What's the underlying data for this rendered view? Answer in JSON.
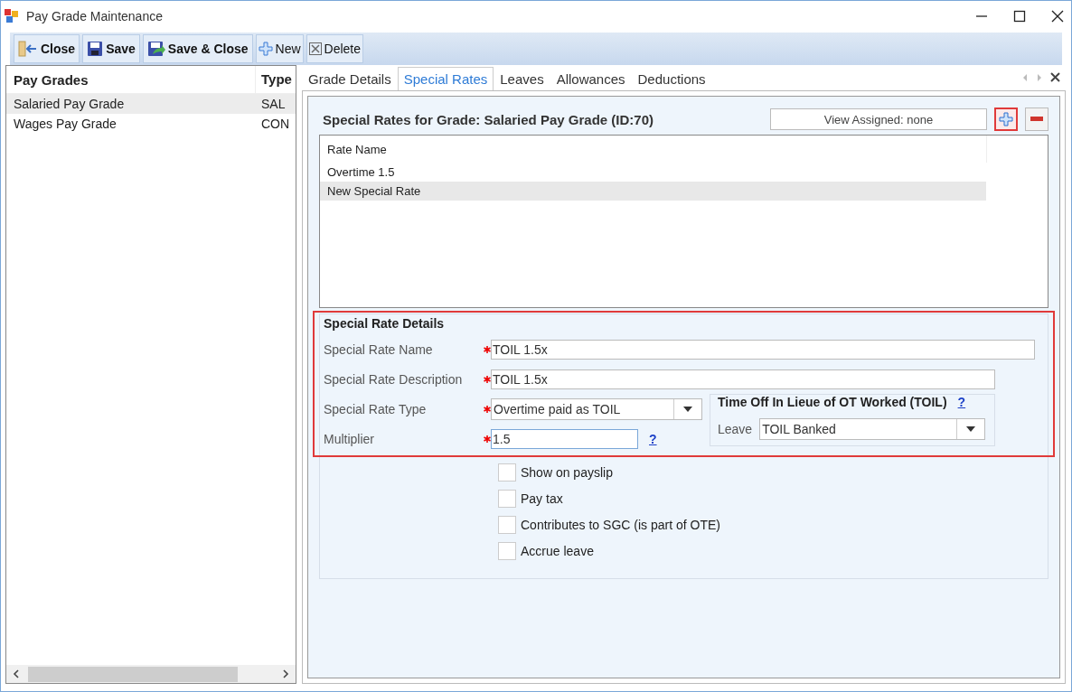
{
  "window": {
    "title": "Pay Grade Maintenance"
  },
  "toolbar": [
    {
      "label": "Close",
      "kind": "close"
    },
    {
      "label": "Save",
      "kind": "save"
    },
    {
      "label": "Save & Close",
      "kind": "save-close"
    },
    {
      "label": "New",
      "kind": "new"
    },
    {
      "label": "Delete",
      "kind": "delete"
    }
  ],
  "pay_grades": {
    "columns": [
      "Pay Grades",
      "Type"
    ],
    "rows": [
      {
        "name": "Salaried Pay Grade",
        "type": "SAL",
        "selected": true
      },
      {
        "name": "Wages Pay Grade",
        "type": "CON",
        "selected": false
      }
    ]
  },
  "tabs": [
    {
      "label": "Grade Details",
      "selected": false
    },
    {
      "label": "Special Rates",
      "selected": true
    },
    {
      "label": "Leaves",
      "selected": false
    },
    {
      "label": "Allowances",
      "selected": false
    },
    {
      "label": "Deductions",
      "selected": false
    }
  ],
  "special_rates": {
    "heading": "Special Rates for Grade: Salaried Pay Grade (ID:70)",
    "view_assigned": "View Assigned: none",
    "add_highlighted": true,
    "column": "Rate Name",
    "rows": [
      {
        "name": "Overtime 1.5",
        "selected": false
      },
      {
        "name": "New Special Rate",
        "selected": true
      }
    ]
  },
  "details": {
    "title": "Special Rate Details",
    "highlighted": true,
    "fields": [
      {
        "label": "Special Rate Name",
        "value": "TOIL 1.5x",
        "required": true,
        "kind": "text",
        "focused": false
      },
      {
        "label": "Special Rate Description",
        "value": "TOIL 1.5x",
        "required": true,
        "kind": "text",
        "focused": false
      },
      {
        "label": "Special Rate Type",
        "value": "Overtime paid as TOIL",
        "required": true,
        "kind": "dropdown",
        "focused": false
      },
      {
        "label": "Multiplier",
        "value": "1.5",
        "required": true,
        "kind": "number",
        "focused": true,
        "help": "?"
      }
    ],
    "toil": {
      "title": "Time Off In Lieue of OT Worked (TOIL)",
      "help": "?",
      "leave_label": "Leave",
      "leave_value": "TOIL Banked"
    },
    "checkboxes": [
      {
        "label": "Show on payslip",
        "checked": false
      },
      {
        "label": "Pay tax",
        "checked": false
      },
      {
        "label": "Contributes to SGC (is part of OTE)",
        "checked": false
      },
      {
        "label": "Accrue leave",
        "checked": false
      }
    ]
  }
}
